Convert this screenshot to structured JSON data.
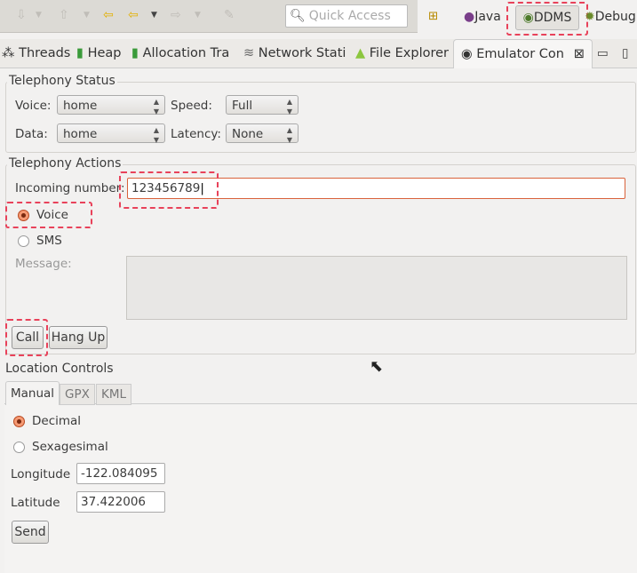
{
  "toolbar": {
    "quick_access_placeholder": "Quick Access",
    "perspectives": [
      "Java",
      "DDMS",
      "Debug"
    ]
  },
  "tabs": [
    "Threads",
    "Heap",
    "Allocation Tra",
    "Network Stati",
    "File Explorer",
    "Emulator Con"
  ],
  "telephony_status": {
    "title": "Telephony Status",
    "voice_label": "Voice:",
    "voice_value": "home",
    "speed_label": "Speed:",
    "speed_value": "Full",
    "data_label": "Data:",
    "data_value": "home",
    "latency_label": "Latency:",
    "latency_value": "None"
  },
  "telephony_actions": {
    "title": "Telephony Actions",
    "incoming_label": "Incoming number:",
    "incoming_value": "123456789",
    "voice": "Voice",
    "sms": "SMS",
    "message_label": "Message:",
    "call": "Call",
    "hang_up": "Hang Up",
    "selected": "Voice"
  },
  "location": {
    "title": "Location Controls",
    "tabs": [
      "Manual",
      "GPX",
      "KML"
    ],
    "decimal": "Decimal",
    "sexagesimal": "Sexagesimal",
    "selected": "Decimal",
    "longitude_label": "Longitude",
    "longitude_value": "-122.084095",
    "latitude_label": "Latitude",
    "latitude_value": "37.422006",
    "send": "Send"
  }
}
